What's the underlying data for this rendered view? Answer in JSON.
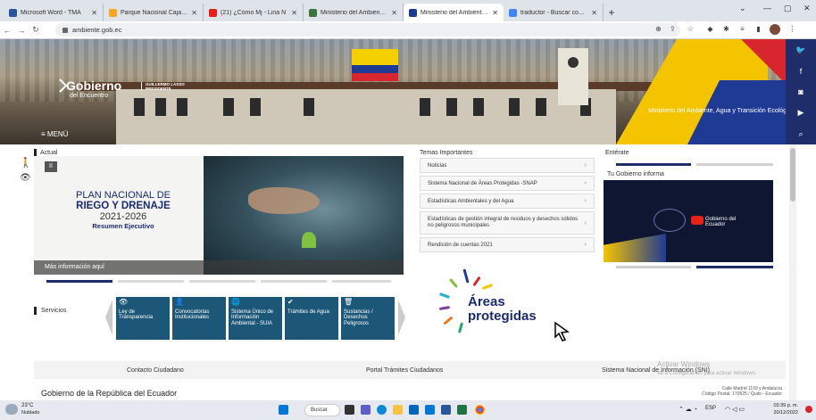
{
  "browser": {
    "tabs": [
      {
        "title": "Microsoft Word - TMA",
        "color": "#2b579a"
      },
      {
        "title": "Parque Nacional Cajas | Sitio",
        "color": "#f5a623"
      },
      {
        "title": "(21) ¿Cómo Mj - Lina N",
        "color": "#e62117"
      },
      {
        "title": "Ministerio del Ambiente |",
        "color": "#3c763d"
      },
      {
        "title": "Ministerio del Ambiente, A",
        "color": "#1f3a93"
      },
      {
        "title": "traductor - Buscar con Goo",
        "color": "#4285f4"
      }
    ],
    "new_tab": "+",
    "url": "ambiente.gob.ec"
  },
  "hero": {
    "logo_main": "Gobierno",
    "logo_sub": "del Encuentro",
    "logo_name": "GUILLERMO LASSO",
    "logo_role": "PRESIDENTE",
    "ministry": "Ministerio del Ambiente, Agua y Transición Ecológica",
    "menu": "≡ MENÚ"
  },
  "accessibility": {
    "icon1": "🚶",
    "icon2": "👁"
  },
  "sections": {
    "actual": "Actual",
    "temas": "Temas Importantes",
    "enterate": "Entérate",
    "servicios": "Servicios",
    "tu_gobierno": "Tu Gobierno informa"
  },
  "banner": {
    "l1": "PLAN NACIONAL DE",
    "l2": "RIEGO Y DRENAJE",
    "l3": "2021-2026",
    "l4": "Resumen Ejecutivo",
    "info": "Más información aquí",
    "pause": "II"
  },
  "temas": [
    "Noticias",
    "Sistema Nacional de Áreas Protegidas -SNAP",
    "Estadísticas Ambientales y del Agua",
    "Estadísticas de gestión integral de residuos y desechos sólidos no peligrosos municipales",
    "Rendición de cuentas 2021"
  ],
  "areas": {
    "t1": "Áreas",
    "t2": "protegidas"
  },
  "servicios": [
    {
      "icon": "👁",
      "label": "Ley de Transparencia"
    },
    {
      "icon": "👤",
      "label": "Convocatorias Institucionales"
    },
    {
      "icon": "🌐",
      "label": "Sistema Único de Información Ambiental - SUIA"
    },
    {
      "icon": "✔",
      "label": "Trámites de Agua"
    },
    {
      "icon": "🗑",
      "label": "Sustancias / Desechos Peligrosos"
    }
  ],
  "video": {
    "brand": "Gobierno del Ecuador"
  },
  "footer": {
    "contact": "Contacto Ciudadano",
    "portal": "Portal Trámites Ciudadanos",
    "snip": "Sistema Nacional de Información (SNI)",
    "gov": "Gobierno de la República del Ecuador",
    "addr1": "Calle Madrid 1159 y Andalucía",
    "addr2": "Código Postal: 170525 / Quito - Ecuador",
    "activate": "Activar Windows",
    "activate2": "Ve a Configuración para activar Windows."
  },
  "taskbar": {
    "temp": "23°C",
    "weather": "Nublado",
    "search": "Buscar",
    "lang": "ESP",
    "time": "03:39 p. m.",
    "date": "20/12/2022"
  }
}
